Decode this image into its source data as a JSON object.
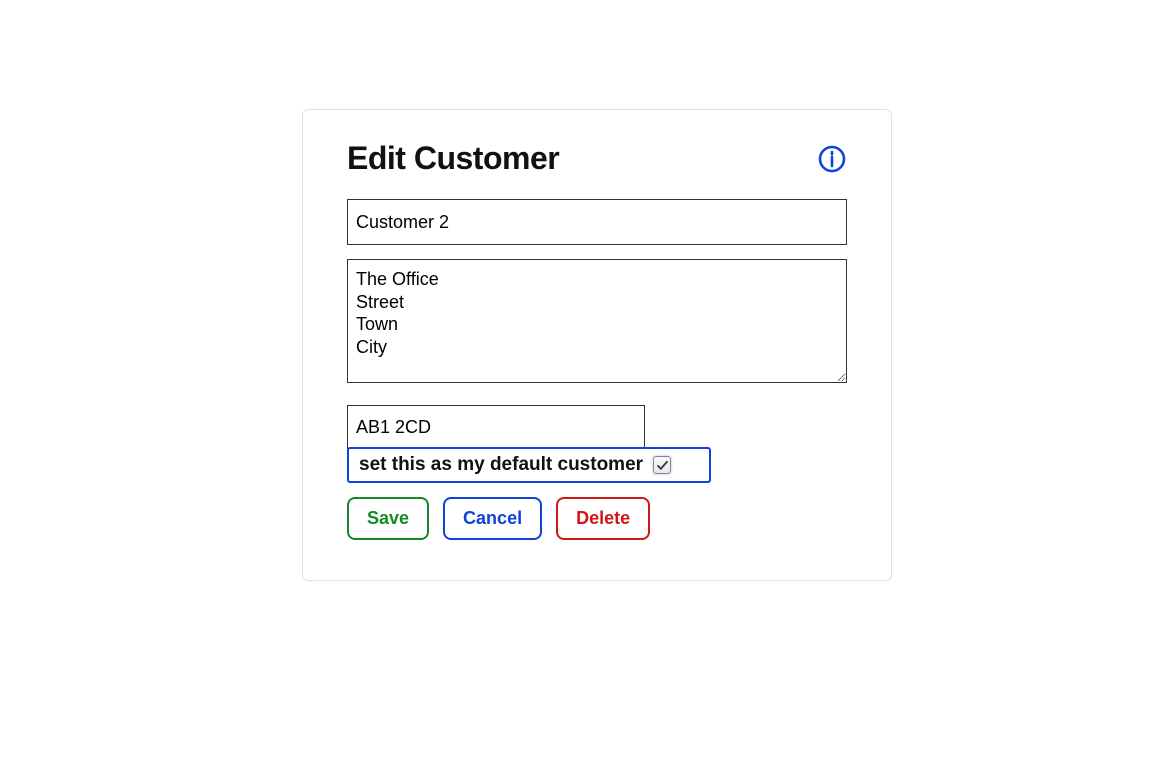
{
  "panel": {
    "title": "Edit Customer",
    "info_icon_name": "info-icon",
    "fields": {
      "name_value": "Customer 2",
      "address_value": "The Office\nStreet\nTown\nCity",
      "postcode_value": "AB1 2CD"
    },
    "default_customer": {
      "label": "set this as my default customer",
      "checked": true
    },
    "buttons": {
      "save": "Save",
      "cancel": "Cancel",
      "delete": "Delete"
    },
    "colors": {
      "accent_blue": "#0c44d8",
      "green": "#138a23",
      "red": "#d01616"
    }
  }
}
